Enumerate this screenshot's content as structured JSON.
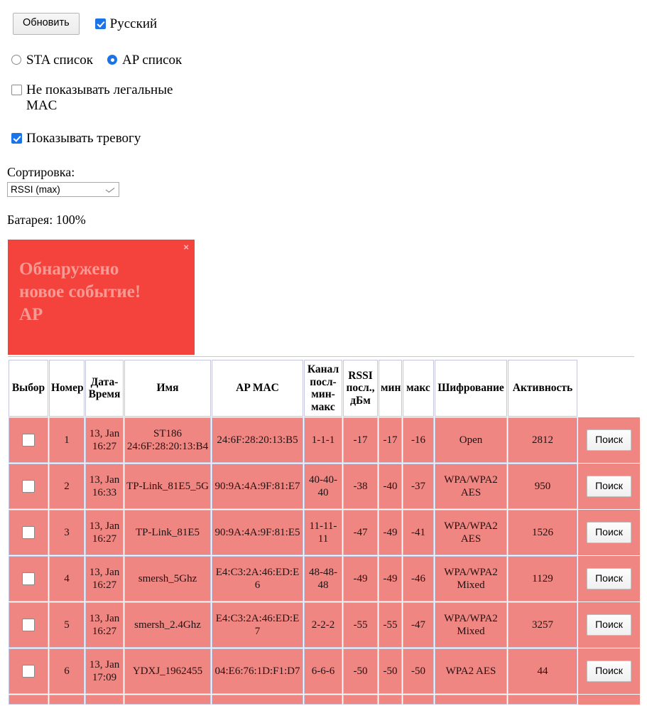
{
  "controls": {
    "refresh_button": "Обновить",
    "language_checkbox": {
      "label": "Русский",
      "checked": true
    },
    "list_mode": {
      "options": [
        {
          "label": "STA список",
          "selected": false
        },
        {
          "label": "AP список",
          "selected": true
        }
      ]
    },
    "hide_legal_mac": {
      "label": "Не показывать легальные MAC",
      "checked": false
    },
    "show_alarm": {
      "label": "Показывать тревогу",
      "checked": true
    },
    "sort": {
      "label": "Сортировка:",
      "value": "RSSI (max)",
      "options": [
        "RSSI (max)"
      ]
    },
    "battery": "Батарея: 100%"
  },
  "alert": {
    "close_label": "×",
    "line1": "Обнаружено",
    "line2": "новое событие!",
    "line3": "AP",
    "bg_color": "#f4433d",
    "text_color": "#f79a94"
  },
  "table": {
    "headers": [
      "Выбор",
      "Номер",
      "Дата-Время",
      "Имя",
      "AP MAC",
      "Канал посл-мин-макс",
      "RSSI посл., дБм",
      "мин",
      "макс",
      "Шифрование",
      "Активность",
      ""
    ],
    "headers_multiline": {
      "date": [
        "Дата-",
        "Время"
      ],
      "channel": [
        "Канал",
        "посл-",
        "мин-",
        "макс"
      ],
      "rssi": [
        "RSSI",
        "посл.,",
        "дБм"
      ]
    },
    "action_label": "Поиск",
    "row_bg_color": "#f08682",
    "rows": [
      {
        "num": "1",
        "datetime": [
          "13, Jan",
          "16:27"
        ],
        "name": [
          "ST186",
          "24:6F:28:20:13:B4"
        ],
        "mac": "24:6F:28:20:13:B5",
        "channel": "1-1-1",
        "rssi_last": "-17",
        "rssi_min": "-17",
        "rssi_max": "-16",
        "encryption": [
          "Open"
        ],
        "activity": "2812",
        "selected": false
      },
      {
        "num": "2",
        "datetime": [
          "13, Jan",
          "16:33"
        ],
        "name": [
          "TP-Link_81E5_5G"
        ],
        "mac": "90:9A:4A:9F:81:E7",
        "channel": "40-40-40",
        "rssi_last": "-38",
        "rssi_min": "-40",
        "rssi_max": "-37",
        "encryption": [
          "WPA/WPA2",
          "AES"
        ],
        "activity": "950",
        "selected": false
      },
      {
        "num": "3",
        "datetime": [
          "13, Jan",
          "16:27"
        ],
        "name": [
          "TP-Link_81E5"
        ],
        "mac": "90:9A:4A:9F:81:E5",
        "channel": "11-11-11",
        "rssi_last": "-47",
        "rssi_min": "-49",
        "rssi_max": "-41",
        "encryption": [
          "WPA/WPA2",
          "AES"
        ],
        "activity": "1526",
        "selected": false
      },
      {
        "num": "4",
        "datetime": [
          "13, Jan",
          "16:27"
        ],
        "name": [
          "smersh_5Ghz"
        ],
        "mac": "E4:C3:2A:46:ED:E6",
        "channel": "48-48-48",
        "rssi_last": "-49",
        "rssi_min": "-49",
        "rssi_max": "-46",
        "encryption": [
          "WPA/WPA2",
          "Mixed"
        ],
        "activity": "1129",
        "selected": false
      },
      {
        "num": "5",
        "datetime": [
          "13, Jan",
          "16:27"
        ],
        "name": [
          "smersh_2.4Ghz"
        ],
        "mac": "E4:C3:2A:46:ED:E7",
        "channel": "2-2-2",
        "rssi_last": "-55",
        "rssi_min": "-55",
        "rssi_max": "-47",
        "encryption": [
          "WPA/WPA2",
          "Mixed"
        ],
        "activity": "3257",
        "selected": false
      },
      {
        "num": "6",
        "datetime": [
          "13, Jan",
          "17:09"
        ],
        "name": [
          "YDXJ_1962455"
        ],
        "mac": "04:E6:76:1D:F1:D7",
        "channel": "6-6-6",
        "rssi_last": "-50",
        "rssi_min": "-50",
        "rssi_max": "-50",
        "encryption": [
          "WPA2 AES"
        ],
        "activity": "44",
        "selected": false
      }
    ]
  }
}
